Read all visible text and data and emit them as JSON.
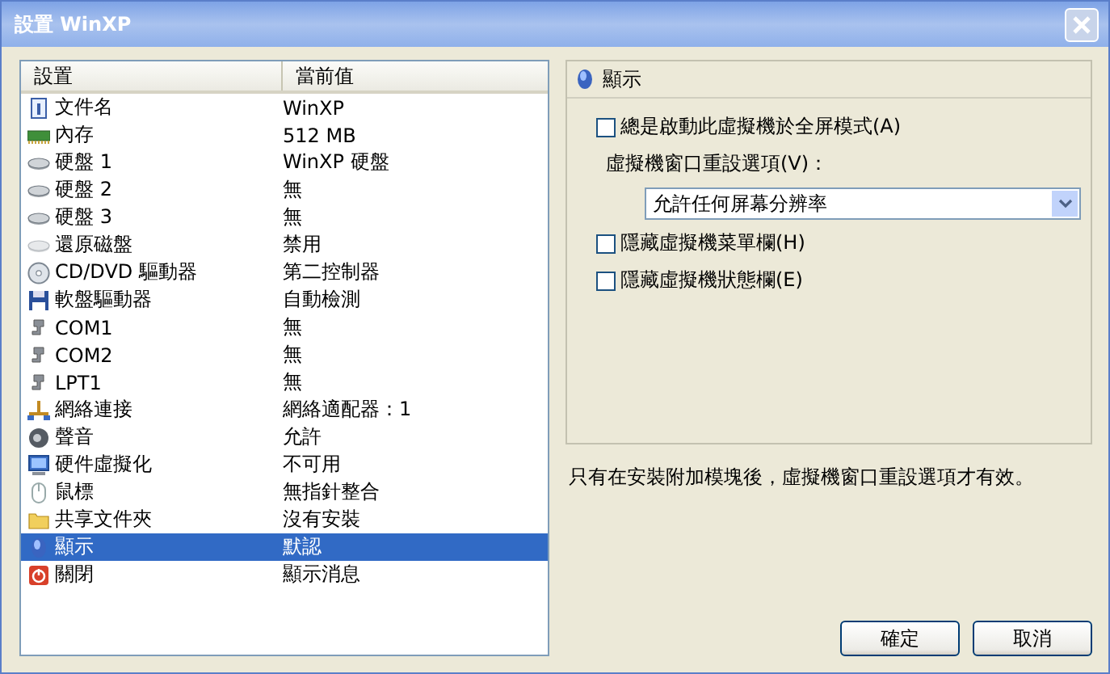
{
  "window": {
    "title": "設置 WinXP"
  },
  "settings": {
    "columns": [
      "設置",
      "當前值"
    ],
    "rows": [
      {
        "name": "文件名",
        "value": "WinXP",
        "selected": false
      },
      {
        "name": "內存",
        "value": "512 MB",
        "selected": false
      },
      {
        "name": "硬盤 1",
        "value": "WinXP 硬盤",
        "selected": false
      },
      {
        "name": "硬盤 2",
        "value": "無",
        "selected": false
      },
      {
        "name": "硬盤 3",
        "value": "無",
        "selected": false
      },
      {
        "name": "還原磁盤",
        "value": "禁用",
        "selected": false
      },
      {
        "name": "CD/DVD 驅動器",
        "value": "第二控制器",
        "selected": false
      },
      {
        "name": "軟盤驅動器",
        "value": "自動檢測",
        "selected": false
      },
      {
        "name": "COM1",
        "value": "無",
        "selected": false
      },
      {
        "name": "COM2",
        "value": "無",
        "selected": false
      },
      {
        "name": "LPT1",
        "value": "無",
        "selected": false
      },
      {
        "name": "網絡連接",
        "value": "網絡適配器：1",
        "selected": false
      },
      {
        "name": "聲音",
        "value": "允許",
        "selected": false
      },
      {
        "name": "硬件虛擬化",
        "value": "不可用",
        "selected": false
      },
      {
        "name": "鼠標",
        "value": "無指針整合",
        "selected": false
      },
      {
        "name": "共享文件夾",
        "value": "沒有安裝",
        "selected": false
      },
      {
        "name": "顯示",
        "value": "默認",
        "selected": true
      },
      {
        "name": "關閉",
        "value": "顯示消息",
        "selected": false
      }
    ]
  },
  "panel": {
    "title": "顯示",
    "fullscreen": {
      "label": "總是啟動此虛擬機於全屏模式(A)",
      "checked": false
    },
    "resize_label": "虛擬機窗口重設選項(V)：",
    "resize_select": {
      "value": "允許任何屏幕分辨率"
    },
    "options": [
      {
        "label": "隱藏虛擬機菜單欄(H)",
        "checked": false
      },
      {
        "label": "隱藏虛擬機狀態欄(E)",
        "checked": false
      }
    ],
    "note": "只有在安裝附加模塊後，虛擬機窗口重設選項才有效。"
  },
  "buttons": [
    "確定",
    "取消"
  ]
}
